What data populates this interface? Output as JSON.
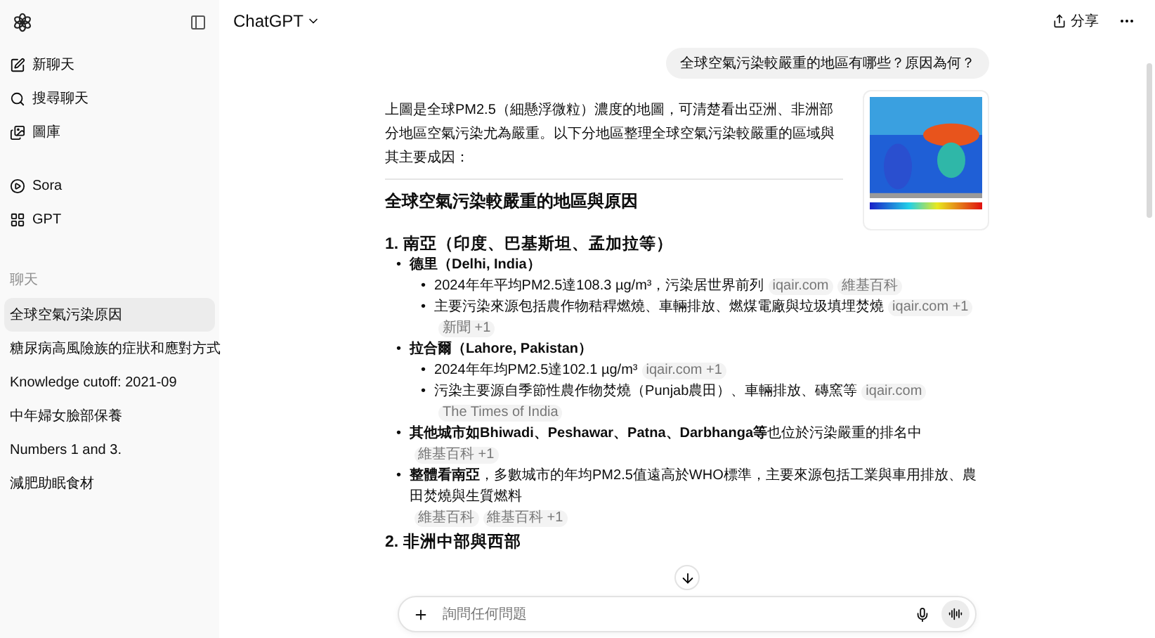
{
  "sidebar": {
    "top_items": [
      {
        "label": "新聊天"
      },
      {
        "label": "搜尋聊天"
      },
      {
        "label": "圖庫"
      }
    ],
    "extra_items": [
      {
        "label": "Sora"
      },
      {
        "label": "GPT"
      }
    ],
    "section_title": "聊天",
    "chats": [
      {
        "label": "全球空氣污染原因",
        "selected": true
      },
      {
        "label": "糖尿病高風險族的症狀和應對方式",
        "selected": false
      },
      {
        "label": "Knowledge cutoff: 2021-09",
        "selected": false
      },
      {
        "label": "中年婦女臉部保養",
        "selected": false
      },
      {
        "label": "Numbers 1 and 3.",
        "selected": false
      },
      {
        "label": "減肥助眠食材",
        "selected": false
      }
    ]
  },
  "header": {
    "title": "ChatGPT",
    "share": "分享"
  },
  "user_message": "全球空氣污染較嚴重的地區有哪些？原因為何？",
  "answer": {
    "intro": "上圖是全球PM2.5（細懸浮微粒）濃度的地圖，可清楚看出亞洲、非洲部分地區空氣污染尤為嚴重。以下分地區整理全球空氣污染較嚴重的區域與其主要成因：",
    "heading": "全球空氣污染較嚴重的地區與原因",
    "sections": [
      {
        "title": "1. 南亞（印度、巴基斯坦、孟加拉等）",
        "items": [
          {
            "marker": "•",
            "text": "**德里（Delhi, India）**",
            "children": [
              {
                "marker": "•",
                "text": "2024年年平均PM2.5達108.3 µg/m³，污染居世界前列",
                "sources": [
                  "iqair.com",
                  "維基百科"
                ]
              },
              {
                "marker": "•",
                "text": "主要污染來源包括農作物秸稈燃燒、車輛排放、燃煤電廠與垃圾填埋焚燒",
                "sources": [
                  "iqair.com +1",
                  "新聞 +1"
                ]
              }
            ]
          },
          {
            "marker": "•",
            "text": "**拉合爾（Lahore, Pakistan）**",
            "children": [
              {
                "marker": "•",
                "text": "2024年年均PM2.5達102.1 µg/m³",
                "sources": [
                  "iqair.com +1"
                ]
              },
              {
                "marker": "•",
                "text": "污染主要源自季節性農作物焚燒（Punjab農田）、車輛排放、磚窯等",
                "sources": [
                  "iqair.com",
                  "The Times of India"
                ]
              }
            ]
          },
          {
            "marker": "•",
            "text": "**其他城市如Bhiwadi、Peshawar、Patna、Darbhanga等**也位於污染嚴重的排名中",
            "sources": [
              "維基百科 +1"
            ]
          },
          {
            "marker": "•",
            "text": "**整體看南亞**，多數城市的年均PM2.5值遠高於WHO標準，主要來源包括工業與車用排放、農田焚燒與生質燃料",
            "sources": [
              "維基百科",
              "維基百科 +1"
            ]
          }
        ]
      },
      {
        "title": "2. 非洲中部與西部"
      }
    ]
  },
  "composer": {
    "placeholder": "詢問任何問題"
  }
}
